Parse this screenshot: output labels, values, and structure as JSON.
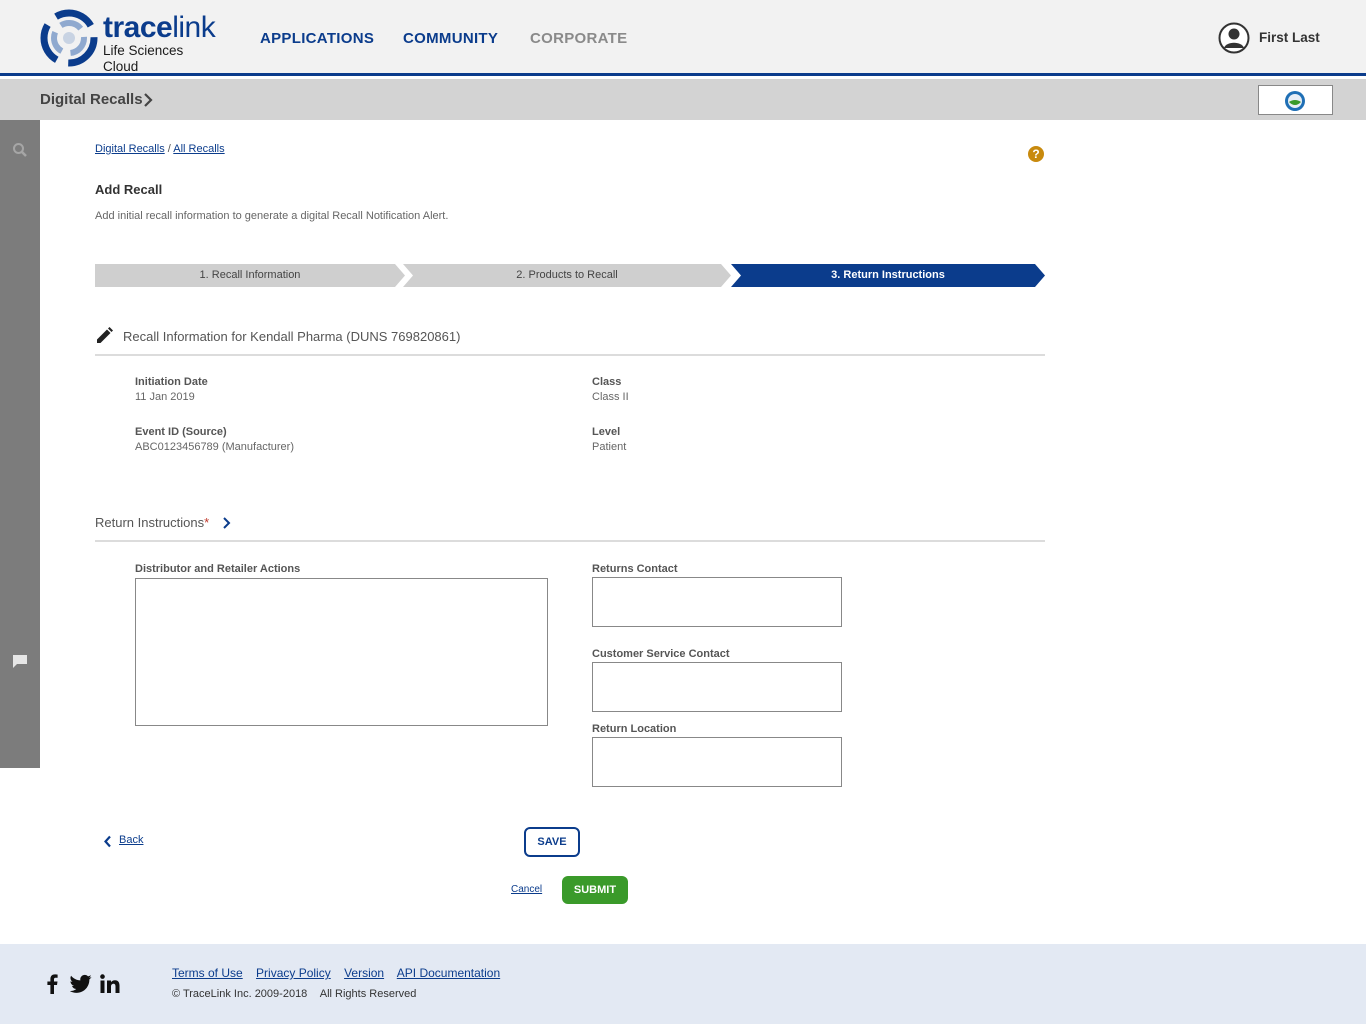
{
  "header": {
    "logo_brand_bold": "trace",
    "logo_brand_light": "link",
    "logo_sub": "Life Sciences Cloud",
    "nav": {
      "applications": "APPLICATIONS",
      "community": "COMMUNITY",
      "corporate": "CORPORATE"
    },
    "user_name": "First Last"
  },
  "subheader": {
    "app_title": "Digital Recalls"
  },
  "breadcrumb": {
    "root": "Digital Recalls",
    "separator": "/",
    "current": "All Recalls"
  },
  "help": {
    "glyph": "?"
  },
  "page": {
    "title": "Add Recall",
    "description": "Add initial recall information to generate a digital Recall Notification Alert."
  },
  "stepper": {
    "steps": [
      {
        "label": "1. Recall Information",
        "state": "completed"
      },
      {
        "label": "2. Products to Recall",
        "state": "completed"
      },
      {
        "label": "3. Return Instructions",
        "state": "active"
      }
    ]
  },
  "recall_info": {
    "title": "Recall Information for Kendall Pharma (DUNS 769820861)",
    "fields": {
      "initiation_date": {
        "label": "Initiation Date",
        "value": "11 Jan 2019"
      },
      "class": {
        "label": "Class",
        "value": "Class II"
      },
      "event_id": {
        "label": "Event ID (Source)",
        "value": "ABC0123456789 (Manufacturer)"
      },
      "level": {
        "label": "Level",
        "value": "Patient"
      }
    }
  },
  "return_instructions": {
    "title": "Return Instructions",
    "required_marker": "*",
    "fields": {
      "distributor_actions": {
        "label": "Distributor and Retailer Actions",
        "value": ""
      },
      "returns_contact": {
        "label": "Returns Contact",
        "value": ""
      },
      "customer_service_contact": {
        "label": "Customer Service Contact",
        "value": ""
      },
      "return_location": {
        "label": "Return Location",
        "value": ""
      }
    }
  },
  "actions": {
    "back": "Back",
    "save": "SAVE",
    "cancel": "Cancel",
    "submit": "SUBMIT"
  },
  "footer": {
    "links": {
      "terms": "Terms of Use",
      "privacy": "Privacy Policy",
      "version": "Version",
      "api_docs": "API Documentation"
    },
    "copyright": "© TraceLink Inc. 2009-2018",
    "rights": "All Rights Reserved",
    "social": [
      "facebook-icon",
      "twitter-icon",
      "linkedin-icon"
    ]
  },
  "colors": {
    "brand_blue": "#0b3c8c",
    "submit_green": "#3a9a2a",
    "help_amber": "#c88a0e",
    "required_red": "#c0392b"
  }
}
